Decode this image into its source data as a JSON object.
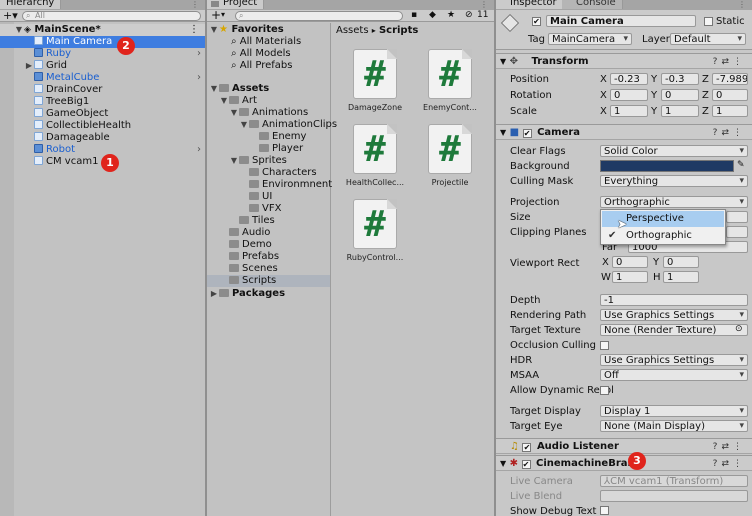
{
  "hierarchy": {
    "tab": "Hierarchy",
    "search_placeholder": "All",
    "scene": "MainScene*",
    "items": [
      "Main Camera",
      "Ruby",
      "Grid",
      "MetalCube",
      "DrainCover",
      "TreeBig1",
      "GameObject",
      "CollectibleHealth",
      "Damageable",
      "Robot",
      "CM vcam1"
    ]
  },
  "project": {
    "tab": "Project",
    "add": "+",
    "count": "11",
    "favorites": {
      "title": "Favorites",
      "items": [
        "All Materials",
        "All Models",
        "All Prefabs"
      ]
    },
    "tree": {
      "assets": "Assets",
      "art": "Art",
      "animations": "Animations",
      "animationclips": "AnimationClips",
      "enemy": "Enemy",
      "player": "Player",
      "sprites": "Sprites",
      "characters": "Characters",
      "environmnent": "Environmnent",
      "ui": "UI",
      "vfx": "VFX",
      "tiles": "Tiles",
      "audio": "Audio",
      "demo": "Demo",
      "prefabs": "Prefabs",
      "scenes": "Scenes",
      "scripts": "Scripts",
      "packages": "Packages"
    },
    "breadcrumb": {
      "root": "Assets",
      "sep": "▸",
      "current": "Scripts"
    },
    "assets": [
      "DamageZone",
      "EnemyCont...",
      "HealthCollec...",
      "Projectile",
      "RubyControl..."
    ]
  },
  "inspector": {
    "tabs": [
      "Inspector",
      "Console"
    ],
    "object_name": "Main Camera",
    "static_label": "Static",
    "tag_label": "Tag",
    "tag_value": "MainCamera",
    "layer_label": "Layer",
    "layer_value": "Default",
    "transform": {
      "title": "Transform",
      "position": {
        "label": "Position",
        "x": "-0.23",
        "y": "-0.3",
        "z": "-7.9898"
      },
      "rotation": {
        "label": "Rotation",
        "x": "0",
        "y": "0",
        "z": "0"
      },
      "scale": {
        "label": "Scale",
        "x": "1",
        "y": "1",
        "z": "1"
      }
    },
    "camera": {
      "title": "Camera",
      "clear_flags": {
        "label": "Clear Flags",
        "value": "Solid Color"
      },
      "background": {
        "label": "Background",
        "color": "#1f3a64"
      },
      "culling_mask": {
        "label": "Culling Mask",
        "value": "Everything"
      },
      "projection": {
        "label": "Projection",
        "value": "Orthographic"
      },
      "size_label": "Size",
      "clipping_label": "Clipping Planes",
      "far_label": "Far",
      "far_value": "1000",
      "viewport": {
        "label": "Viewport Rect",
        "x": "0",
        "y": "0",
        "w": "1",
        "h": "1"
      },
      "depth": {
        "label": "Depth",
        "value": "-1"
      },
      "rendering_path": {
        "label": "Rendering Path",
        "value": "Use Graphics Settings"
      },
      "target_texture": {
        "label": "Target Texture",
        "value": "None (Render Texture)"
      },
      "occlusion_label": "Occlusion Culling",
      "hdr": {
        "label": "HDR",
        "value": "Use Graphics Settings"
      },
      "msaa": {
        "label": "MSAA",
        "value": "Off"
      },
      "dynamic_res_label": "Allow Dynamic Resol",
      "target_display": {
        "label": "Target Display",
        "value": "Display 1"
      },
      "target_eye": {
        "label": "Target Eye",
        "value": "None (Main Display)"
      }
    },
    "projection_dropdown": {
      "options": [
        "Perspective",
        "Orthographic"
      ],
      "hover": "Perspective",
      "checked": "Orthographic"
    },
    "audio_listener": {
      "title": "Audio Listener"
    },
    "brain": {
      "title": "CinemachineBrain",
      "live_camera": {
        "label": "Live Camera",
        "value": "CM vcam1 (Transform)"
      },
      "live_blend_label": "Live Blend",
      "debug_label": "Show Debug Text"
    }
  },
  "annotations": [
    "1",
    "2",
    "3"
  ],
  "colors": {
    "selection": "#3e7de0",
    "prefab_blue": "#1a5fd0",
    "badge": "#e0241c",
    "script_hash": "#1e7a3b"
  }
}
